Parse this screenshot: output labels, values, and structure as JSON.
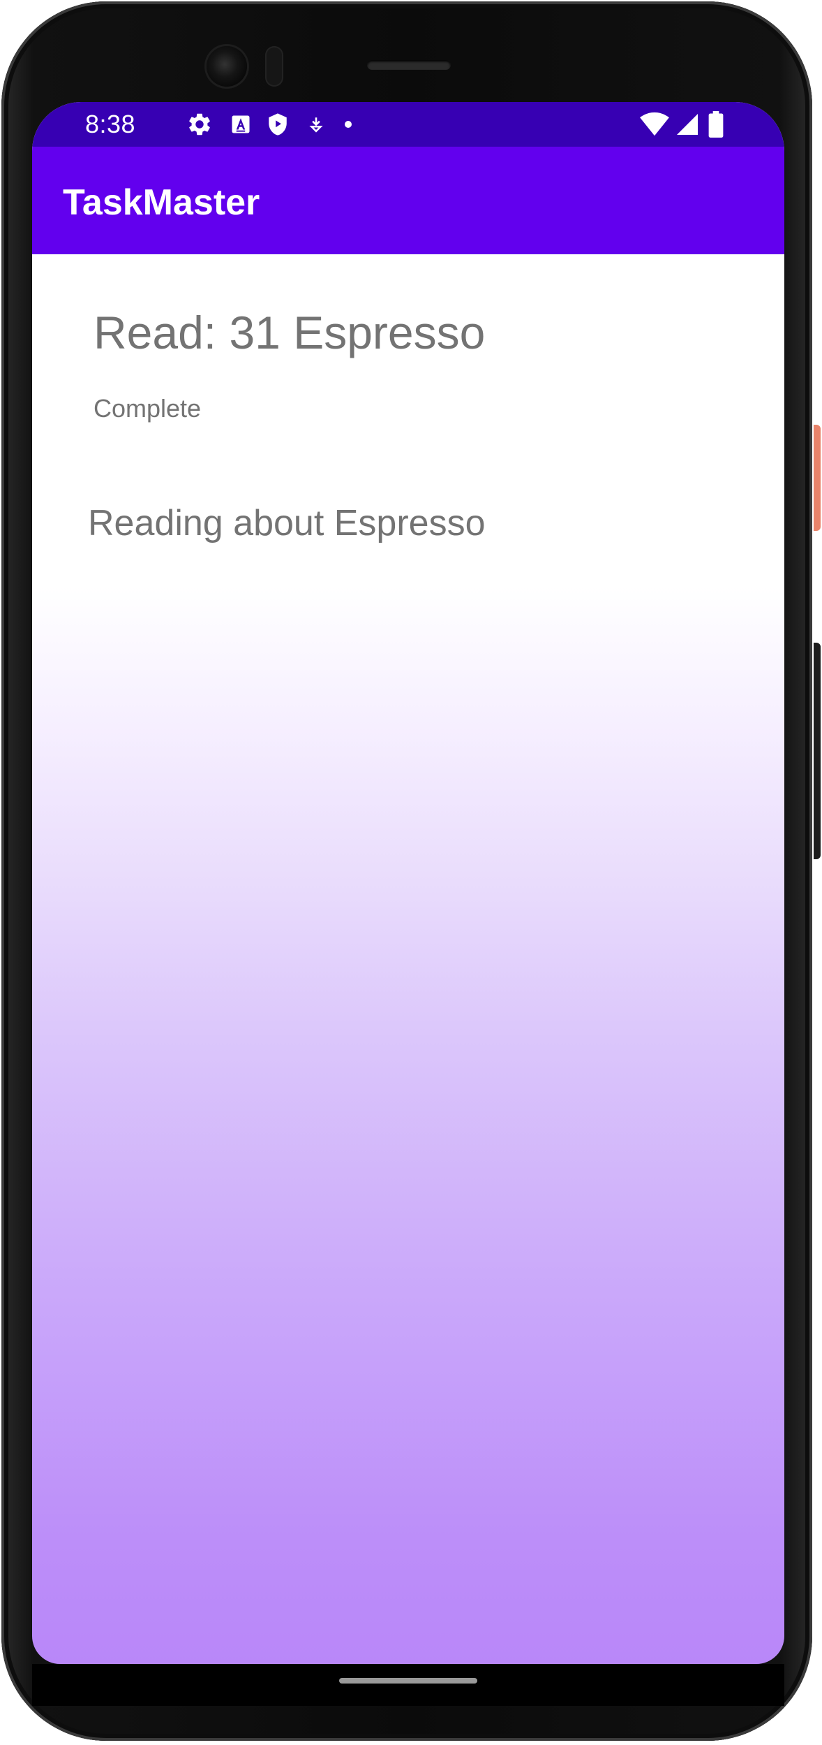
{
  "status_bar": {
    "time": "8:38",
    "icons": [
      "gear-icon",
      "font-a-icon",
      "shield-play-icon",
      "download-icon",
      "dot-icon",
      "wifi-icon",
      "signal-icon",
      "battery-icon"
    ]
  },
  "app_bar": {
    "title": "TaskMaster"
  },
  "task": {
    "title": "Read: 31 Espresso",
    "status": "Complete",
    "body": "Reading about Espresso"
  },
  "colors": {
    "status_bar": "#3700b3",
    "app_bar": "#6200ee",
    "text_secondary": "#737373",
    "gradient_bottom": "#b987f9"
  }
}
